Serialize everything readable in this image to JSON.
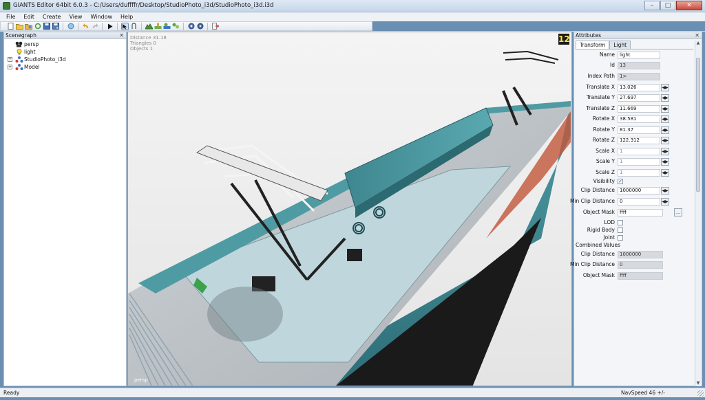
{
  "window": {
    "title": "GIANTS Editor 64bit 6.0.3 - C:/Users/duffffr/Desktop/StudioPhoto_i3d/StudioPhoto_i3d.i3d"
  },
  "menu": [
    "File",
    "Edit",
    "Create",
    "View",
    "Window",
    "Help"
  ],
  "toolbar": {
    "icons": [
      "new-file-icon",
      "open-folder-icon",
      "open-recent-icon",
      "reload-icon",
      "save-icon",
      "save-as-icon",
      "hand-icon",
      "undo-icon",
      "redo-icon",
      "play-icon",
      "select-tool-icon",
      "move-tool-icon",
      "terrain-icon",
      "paint-icon",
      "foliage-icon",
      "decal-icon",
      "settings-icon",
      "preferences-icon",
      "exit-icon"
    ]
  },
  "scenegraph": {
    "title": "Scenegraph",
    "items": [
      {
        "label": "persp",
        "icon": "camera-icon",
        "expandable": false
      },
      {
        "label": "light",
        "icon": "lightbulb-icon",
        "expandable": false
      },
      {
        "label": "StudioPhoto_i3d",
        "icon": "transform-group-icon",
        "expandable": true
      },
      {
        "label": "Model",
        "icon": "transform-group-icon",
        "expandable": true
      }
    ]
  },
  "viewport": {
    "info": [
      "Distance 31.18",
      "Triangles 0",
      "Objects 1"
    ],
    "badge": "12",
    "camera": "persp"
  },
  "attributes": {
    "title": "Attributes",
    "tabs": [
      "Transform",
      "Light"
    ],
    "active_tab": "Transform",
    "fields": {
      "name": {
        "label": "Name",
        "value": "light"
      },
      "id": {
        "label": "Id",
        "value": "13"
      },
      "index_path": {
        "label": "Index Path",
        "value": "1>"
      },
      "translate_x": {
        "label": "Translate X",
        "value": "13.026"
      },
      "translate_y": {
        "label": "Translate Y",
        "value": "27.697"
      },
      "translate_z": {
        "label": "Translate Z",
        "value": "11.669"
      },
      "rotate_x": {
        "label": "Rotate X",
        "value": "38.581"
      },
      "rotate_y": {
        "label": "Rotate Y",
        "value": "81.37"
      },
      "rotate_z": {
        "label": "Rotate Z",
        "value": "122.312"
      },
      "scale_x": {
        "label": "Scale X",
        "value": "1"
      },
      "scale_y": {
        "label": "Scale Y",
        "value": "1"
      },
      "scale_z": {
        "label": "Scale Z",
        "value": "1"
      },
      "visibility": {
        "label": "Visibility",
        "checked": true
      },
      "clip_distance": {
        "label": "Clip Distance",
        "value": "1000000"
      },
      "min_clip_distance": {
        "label": "Min Clip Distance",
        "value": "0"
      },
      "object_mask": {
        "label": "Object Mask",
        "value": "ffff",
        "button": "..."
      },
      "lod": {
        "label": "LOD",
        "checked": false
      },
      "rigid_body": {
        "label": "Rigid Body",
        "checked": false
      },
      "joint": {
        "label": "Joint",
        "checked": false
      }
    },
    "combined": {
      "title": "Combined Values",
      "clip_distance": {
        "label": "Clip Distance",
        "value": "1000000"
      },
      "min_clip_distance": {
        "label": "Min Clip Distance",
        "value": "0"
      },
      "object_mask": {
        "label": "Object Mask",
        "value": "ffff"
      }
    }
  },
  "status": {
    "left": "Ready",
    "right": "NavSpeed 46 +/-"
  },
  "colors": {
    "train_teal": "#4f9ba3",
    "viewport_bg": "#eeeeee",
    "badge_yellow": "#f6e34a"
  }
}
